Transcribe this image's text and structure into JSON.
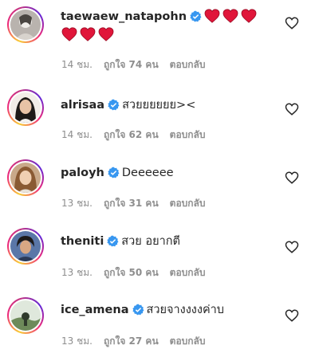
{
  "comments": [
    {
      "username": "taewaew_natapohn",
      "verified": true,
      "text": "",
      "emoji": "red-heart x6",
      "time": "14 ชม.",
      "likes": "ถูกใจ 74 คน",
      "reply": "ตอบกลับ",
      "like_icon": "heart-outline-icon"
    },
    {
      "username": "alrisaa",
      "verified": true,
      "text": "สวยยยยยย><",
      "time": "14 ชม.",
      "likes": "ถูกใจ 62 คน",
      "reply": "ตอบกลับ",
      "like_icon": "heart-outline-icon"
    },
    {
      "username": "paloyh",
      "verified": true,
      "text": "Deeeeee",
      "time": "13 ชม.",
      "likes": "ถูกใจ 31 คน",
      "reply": "ตอบกลับ",
      "like_icon": "heart-outline-icon"
    },
    {
      "username": "theniti",
      "verified": true,
      "text": "สวย อยากตี",
      "time": "13 ชม.",
      "likes": "ถูกใจ 50 คน",
      "reply": "ตอบกลับ",
      "like_icon": "heart-outline-icon"
    },
    {
      "username": "ice_amena",
      "verified": true,
      "text": "สวยจางงงงค่าบ",
      "time": "13 ชม.",
      "likes": "ถูกใจ 27 คน",
      "reply": "ตอบกลับ",
      "like_icon": "heart-outline-icon"
    }
  ],
  "colors": {
    "verified_blue": "#3897f0",
    "heart_red": "#e0163a",
    "meta_gray": "#8e8e8e",
    "text": "#262626"
  }
}
